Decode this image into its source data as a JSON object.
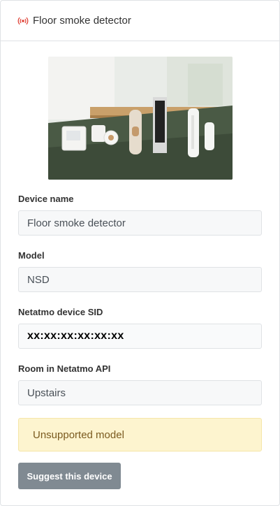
{
  "header": {
    "title": "Floor smoke detector",
    "icon": "smoke-signal-icon",
    "icon_color": "#e0453a"
  },
  "fields": [
    {
      "label": "Device name",
      "value": "Floor smoke detector"
    },
    {
      "label": "Model",
      "value": "NSD"
    },
    {
      "label": "Netatmo device SID",
      "value": "xx:xx:xx:xx:xx:xx"
    },
    {
      "label": "Room in Netatmo API",
      "value": "Upstairs"
    }
  ],
  "alert": {
    "text": "Unsupported model"
  },
  "actions": {
    "suggest_label": "Suggest this device"
  }
}
